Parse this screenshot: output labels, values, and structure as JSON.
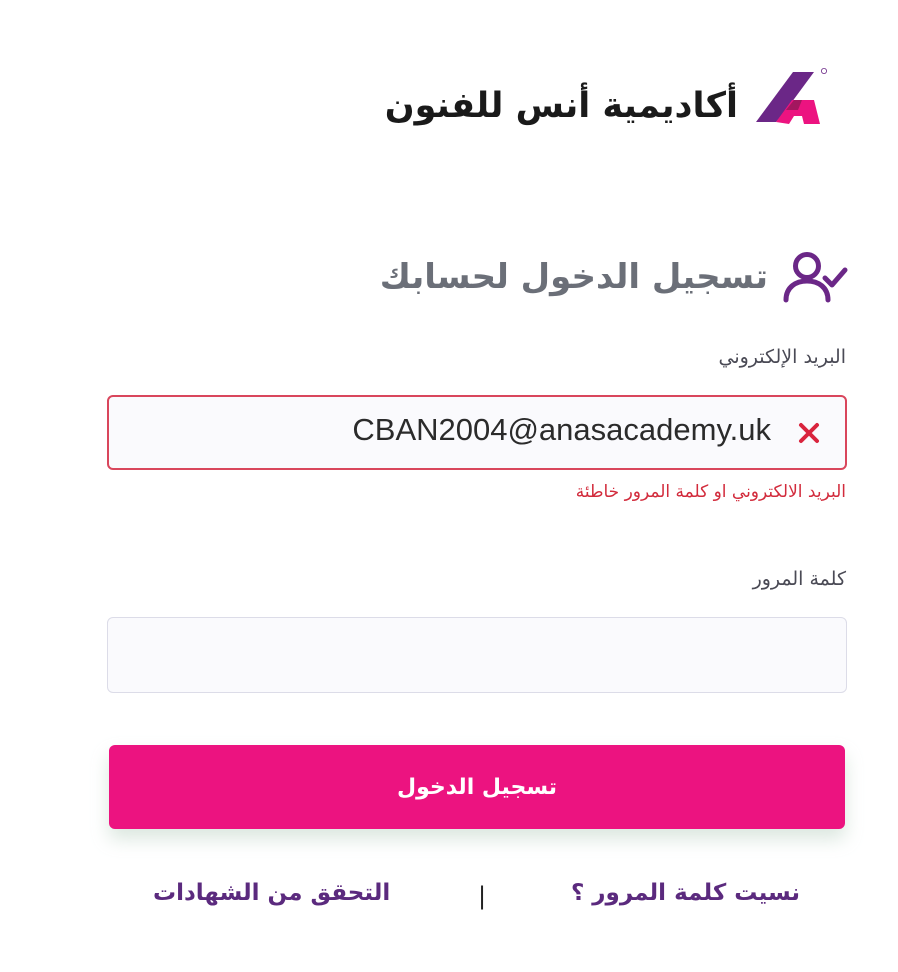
{
  "brand": {
    "name": "أكاديمية أنس للفنون",
    "logo_icon": "anas-academy-logo",
    "colors": {
      "purple": "#6b2787",
      "pink": "#ec1380"
    }
  },
  "login": {
    "title": "تسجيل الدخول لحسابك",
    "title_icon": "user-check-icon",
    "email": {
      "label": "البريد الإلكتروني",
      "value": "CBAN2004@anasacademy.uk",
      "clear_icon": "close-icon",
      "error": "البريد الالكتروني او كلمة المرور خاطئة"
    },
    "password": {
      "label": "كلمة المرور",
      "value": ""
    },
    "submit_label": "تسجيل الدخول"
  },
  "footer": {
    "forgot_password": "نسيت كلمة المرور ؟",
    "divider": "|",
    "verify_certificates": "التحقق من الشهادات"
  },
  "colors": {
    "error": "#d22b3c",
    "link": "#5b2a7e",
    "button": "#ec1380",
    "heading": "#6b6f78"
  }
}
